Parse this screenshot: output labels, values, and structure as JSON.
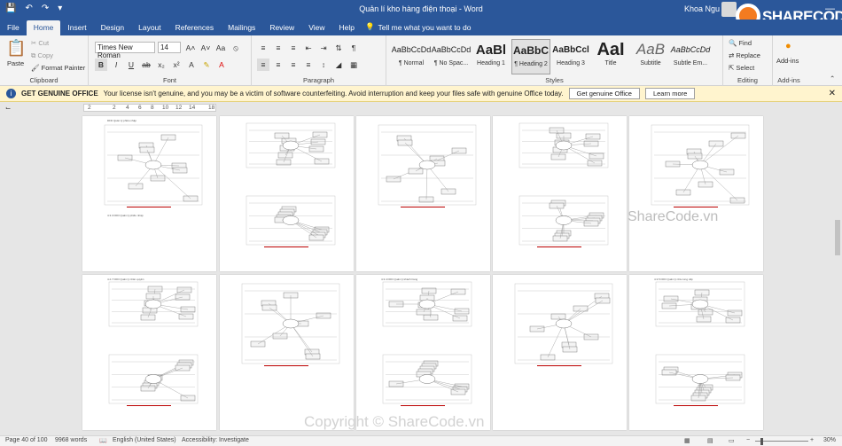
{
  "titlebar": {
    "title": "Quản lí kho hàng điện thoại - Word",
    "user": "Khoa Ngu"
  },
  "logo": {
    "text": "SHARECODE.vn"
  },
  "tabs": [
    "File",
    "Home",
    "Insert",
    "Design",
    "Layout",
    "References",
    "Mailings",
    "Review",
    "View",
    "Help"
  ],
  "tell_me": "Tell me what you want to do",
  "clipboard": {
    "paste": "Paste",
    "cut": "Cut",
    "copy": "Copy",
    "format_painter": "Format Painter",
    "label": "Clipboard"
  },
  "font": {
    "name": "Times New Roman",
    "size": "14",
    "label": "Font"
  },
  "paragraph": {
    "label": "Paragraph"
  },
  "styles": {
    "label": "Styles",
    "items": [
      {
        "preview": "AaBbCcDd",
        "name": "¶ Normal"
      },
      {
        "preview": "AaBbCcDd",
        "name": "¶ No Spac..."
      },
      {
        "preview": "AaBl",
        "name": "Heading 1"
      },
      {
        "preview": "AaBbC",
        "name": "¶ Heading 2"
      },
      {
        "preview": "AaBbCcl",
        "name": "Heading 3"
      },
      {
        "preview": "AaI",
        "name": "Title"
      },
      {
        "preview": "AaB",
        "name": "Subtitle"
      },
      {
        "preview": "AaBbCcDd",
        "name": "Subtle Em..."
      }
    ]
  },
  "editing": {
    "find": "Find",
    "replace": "Replace",
    "select": "Select",
    "label": "Editing"
  },
  "addins": {
    "label": "Add-ins",
    "button": "Add-ins"
  },
  "infobar": {
    "title": "GET GENUINE OFFICE",
    "message": "Your license isn't genuine, and you may be a victim of software counterfeiting. Avoid interruption and keep your files safe with genuine Office today.",
    "btn1": "Get genuine Office",
    "btn2": "Learn more"
  },
  "ruler": [
    "2",
    "2",
    "4",
    "6",
    "8",
    "10",
    "12",
    "14",
    "18"
  ],
  "watermarks": {
    "a": "ShareCode.vn",
    "b": "Copyright © ShareCode.vn"
  },
  "status": {
    "page": "Page 40 of 100",
    "words": "9968 words",
    "lang": "English (United States)",
    "access": "Accessibility: Investigate",
    "zoom": "30%"
  },
  "page_captions": {
    "p1a": "DFD Quản lý phiếu nhập",
    "p1b": "4.3.3 DFD Quản lý phiếu nhập",
    "p6a": "4.2.7 DFD Quản lý nhân quyền",
    "p8a": "4.3.4 DFD Quản lý khách hàng",
    "p10a": "4.3.5 DFD Quản lý nhà cung cấp"
  }
}
